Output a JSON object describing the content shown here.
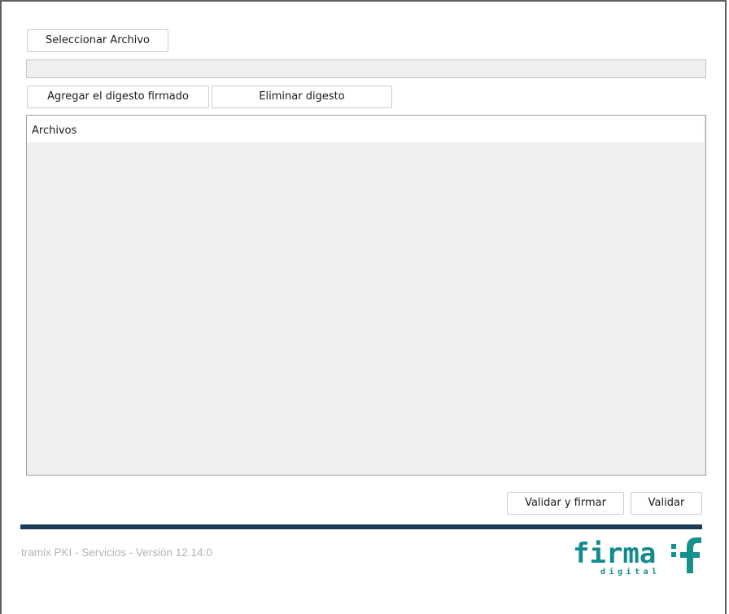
{
  "toolbar": {
    "select_file_label": "Seleccionar Archivo",
    "file_path_value": "",
    "add_digest_label": "Agregar el digesto firmado",
    "remove_digest_label": "Eliminar digesto"
  },
  "files": {
    "header": "Archivos",
    "items": []
  },
  "actions": {
    "validate_sign_label": "Validar y firmar",
    "validate_label": "Validar"
  },
  "footer": {
    "version_text": "tramix PKI - Servicios - Versión 12.14.0",
    "logo": {
      "word": "firma",
      "subword": "digital",
      "mark": "f",
      "color": "#128a8f",
      "mark_color": "#15918f"
    }
  },
  "colors": {
    "divider": "#1b3b56",
    "panel_bg": "#efefef",
    "footer_text": "#b4b4b4"
  }
}
